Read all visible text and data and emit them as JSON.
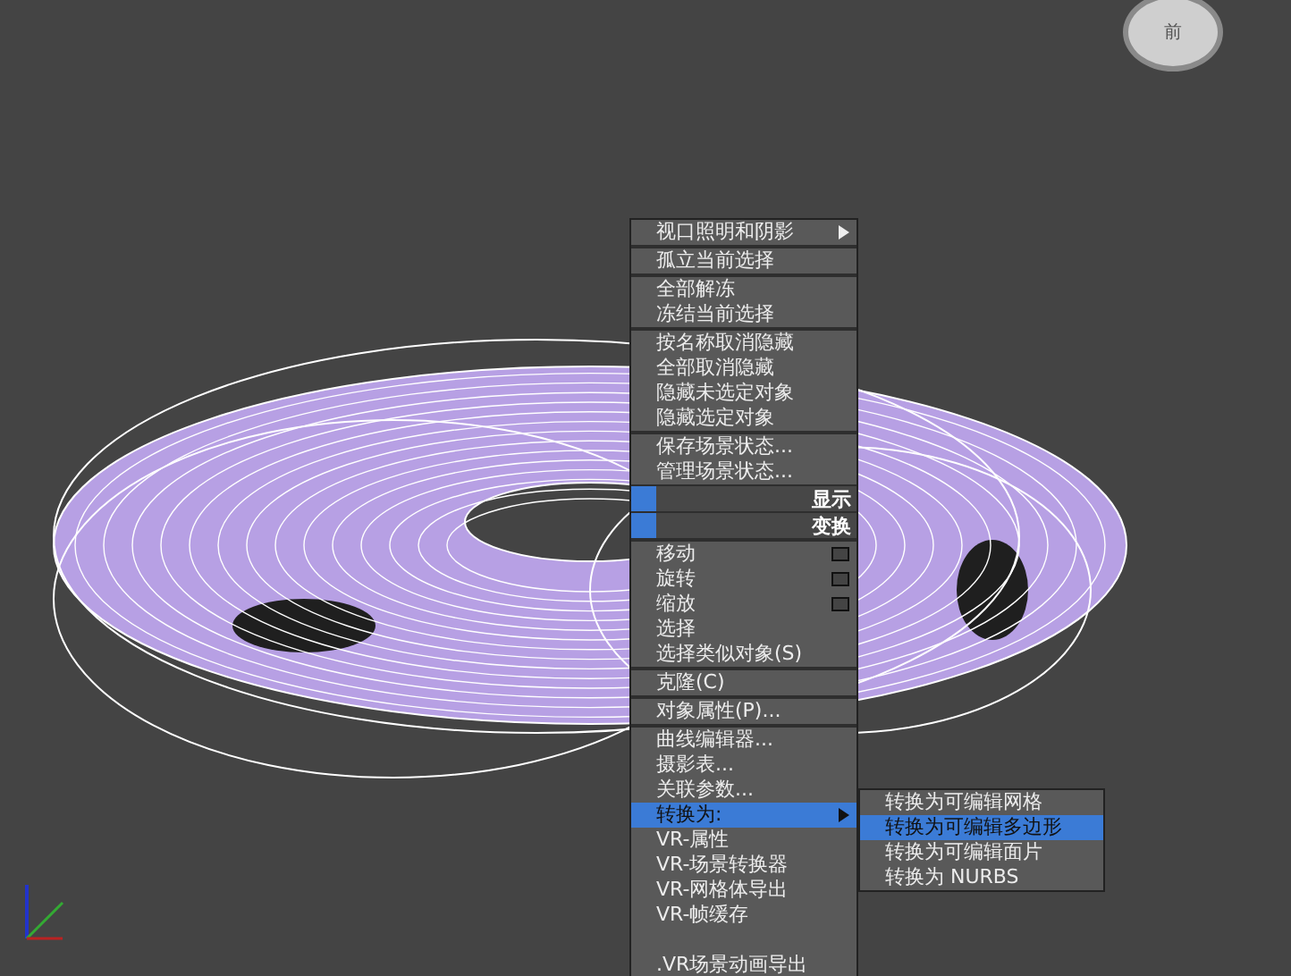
{
  "viewcube": {
    "label": "前"
  },
  "quad_menu": {
    "sections": [
      {
        "items": [
          {
            "label": "视口照明和阴影",
            "kind": "submenu",
            "selected": false
          }
        ]
      },
      {
        "items": [
          {
            "label": "孤立当前选择",
            "kind": "item",
            "selected": false
          }
        ]
      },
      {
        "items": [
          {
            "label": "全部解冻",
            "kind": "item",
            "selected": false
          },
          {
            "label": "冻结当前选择",
            "kind": "item",
            "selected": false
          }
        ]
      },
      {
        "items": [
          {
            "label": "按名称取消隐藏",
            "kind": "item",
            "selected": false
          },
          {
            "label": "全部取消隐藏",
            "kind": "item",
            "selected": false
          },
          {
            "label": "隐藏未选定对象",
            "kind": "item",
            "selected": false
          },
          {
            "label": "隐藏选定对象",
            "kind": "item",
            "selected": false
          }
        ]
      },
      {
        "items": [
          {
            "label": "保存场景状态...",
            "kind": "item",
            "selected": false
          },
          {
            "label": "管理场景状态...",
            "kind": "item",
            "selected": false
          },
          {
            "label": "显示",
            "kind": "header",
            "selected": false
          },
          {
            "label": "变换",
            "kind": "header",
            "selected": false
          }
        ]
      },
      {
        "items": [
          {
            "label": "移动",
            "kind": "option",
            "selected": false
          },
          {
            "label": "旋转",
            "kind": "option",
            "selected": false
          },
          {
            "label": "缩放",
            "kind": "option",
            "selected": false
          },
          {
            "label": "选择",
            "kind": "item",
            "selected": false
          },
          {
            "label": "选择类似对象(S)",
            "kind": "item",
            "selected": false
          }
        ]
      },
      {
        "items": [
          {
            "label": "克隆(C)",
            "kind": "item",
            "selected": false
          }
        ]
      },
      {
        "items": [
          {
            "label": "对象属性(P)...",
            "kind": "item",
            "selected": false
          }
        ]
      },
      {
        "items": [
          {
            "label": "曲线编辑器...",
            "kind": "item",
            "selected": false
          },
          {
            "label": "摄影表...",
            "kind": "item",
            "selected": false
          },
          {
            "label": "关联参数...",
            "kind": "item",
            "selected": false
          },
          {
            "label": "转换为:",
            "kind": "submenu",
            "selected": true
          },
          {
            "label": "VR-属性",
            "kind": "item",
            "selected": false
          },
          {
            "label": "VR-场景转换器",
            "kind": "item",
            "selected": false
          },
          {
            "label": "VR-网格体导出",
            "kind": "item",
            "selected": false
          },
          {
            "label": "VR-帧缓存",
            "kind": "item",
            "selected": false
          },
          {
            "label": ".VR场景动画导出",
            "kind": "item",
            "selected": false
          }
        ]
      }
    ]
  },
  "convert_submenu": [
    {
      "label": "转换为可编辑网格",
      "selected": false
    },
    {
      "label": "转换为可编辑多边形",
      "selected": true
    },
    {
      "label": "转换为可编辑面片",
      "selected": false
    },
    {
      "label": "转换为 NURBS",
      "selected": false
    }
  ]
}
